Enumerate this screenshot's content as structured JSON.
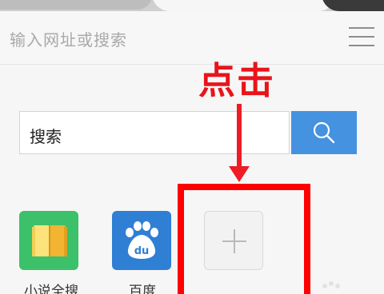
{
  "address_bar": {
    "placeholder": "输入网址或搜索",
    "menu_icon": "hamburger-menu-icon"
  },
  "annotation": {
    "text": "点击",
    "color": "#e8141a"
  },
  "search": {
    "placeholder": "搜索",
    "button_icon": "search-icon",
    "button_color": "#4592e0"
  },
  "shortcuts": [
    {
      "label": "小说全搜",
      "icon": "open-book-icon",
      "color": "#3cc06a"
    },
    {
      "label": "百度",
      "icon": "baidu-paw-icon",
      "color": "#2f7fd4"
    }
  ],
  "add_tile": {
    "icon": "plus-icon"
  }
}
